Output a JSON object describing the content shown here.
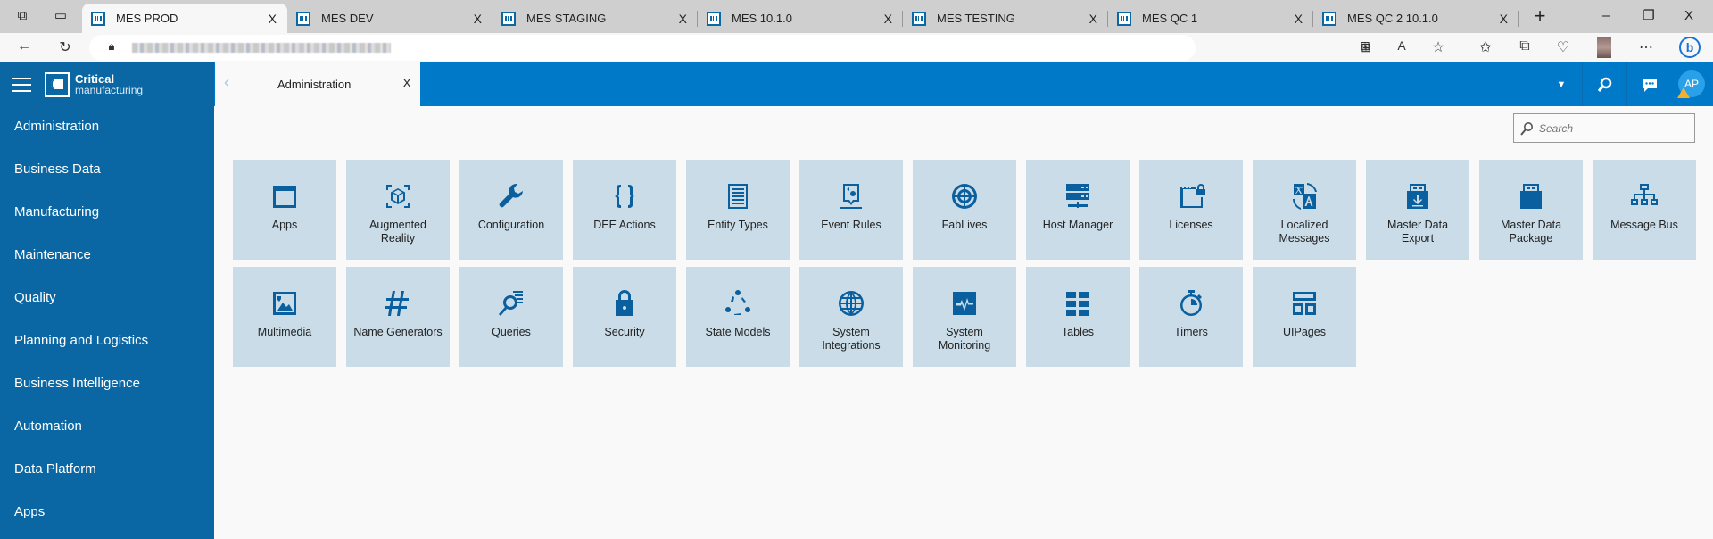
{
  "browser": {
    "tabs": [
      {
        "label": "MES PROD",
        "active": true
      },
      {
        "label": "MES DEV"
      },
      {
        "label": "MES STAGING"
      },
      {
        "label": "MES 10.1.0"
      },
      {
        "label": "MES TESTING"
      },
      {
        "label": "MES QC 1"
      },
      {
        "label": "MES QC 2 10.1.0"
      }
    ],
    "new_tab": "+",
    "minimize": "–",
    "restore": "❐",
    "close": "X",
    "tab_close": "X"
  },
  "app": {
    "brand_line1": "Critical",
    "brand_line2": "manufacturing",
    "open_tab": "Administration",
    "open_tab_close": "X",
    "avatar": "AP",
    "search_placeholder": "Search",
    "accent": "#0079c8",
    "sidebar_color": "#0b67a3",
    "tile_color": "#c9dce8"
  },
  "sidebar": {
    "items": [
      "Administration",
      "Business Data",
      "Manufacturing",
      "Maintenance",
      "Quality",
      "Planning and Logistics",
      "Business Intelligence",
      "Automation",
      "Data Platform",
      "Apps"
    ]
  },
  "tiles": [
    {
      "label": "Apps",
      "icon": "window-icon"
    },
    {
      "label": "Augmented Reality",
      "icon": "ar-cube-icon"
    },
    {
      "label": "Configuration",
      "icon": "wrench-icon"
    },
    {
      "label": "DEE Actions",
      "icon": "braces-icon"
    },
    {
      "label": "Entity Types",
      "icon": "document-lines-icon"
    },
    {
      "label": "Event Rules",
      "icon": "event-rule-icon"
    },
    {
      "label": "FabLives",
      "icon": "fablive-icon"
    },
    {
      "label": "Host Manager",
      "icon": "server-icon"
    },
    {
      "label": "Licenses",
      "icon": "license-lock-icon"
    },
    {
      "label": "Localized Messages",
      "icon": "translate-icon"
    },
    {
      "label": "Master Data Export",
      "icon": "export-icon"
    },
    {
      "label": "Master Data Package",
      "icon": "package-icon"
    },
    {
      "label": "Message Bus",
      "icon": "network-icon"
    },
    {
      "label": "Multimedia",
      "icon": "image-icon"
    },
    {
      "label": "Name Generators",
      "icon": "hash-icon"
    },
    {
      "label": "Queries",
      "icon": "query-icon"
    },
    {
      "label": "Security",
      "icon": "lock-icon"
    },
    {
      "label": "State Models",
      "icon": "state-cycle-icon"
    },
    {
      "label": "System Integrations",
      "icon": "globe-icon"
    },
    {
      "label": "System Monitoring",
      "icon": "monitor-pulse-icon"
    },
    {
      "label": "Tables",
      "icon": "table-icon"
    },
    {
      "label": "Timers",
      "icon": "stopwatch-icon"
    },
    {
      "label": "UIPages",
      "icon": "layout-icon"
    }
  ]
}
